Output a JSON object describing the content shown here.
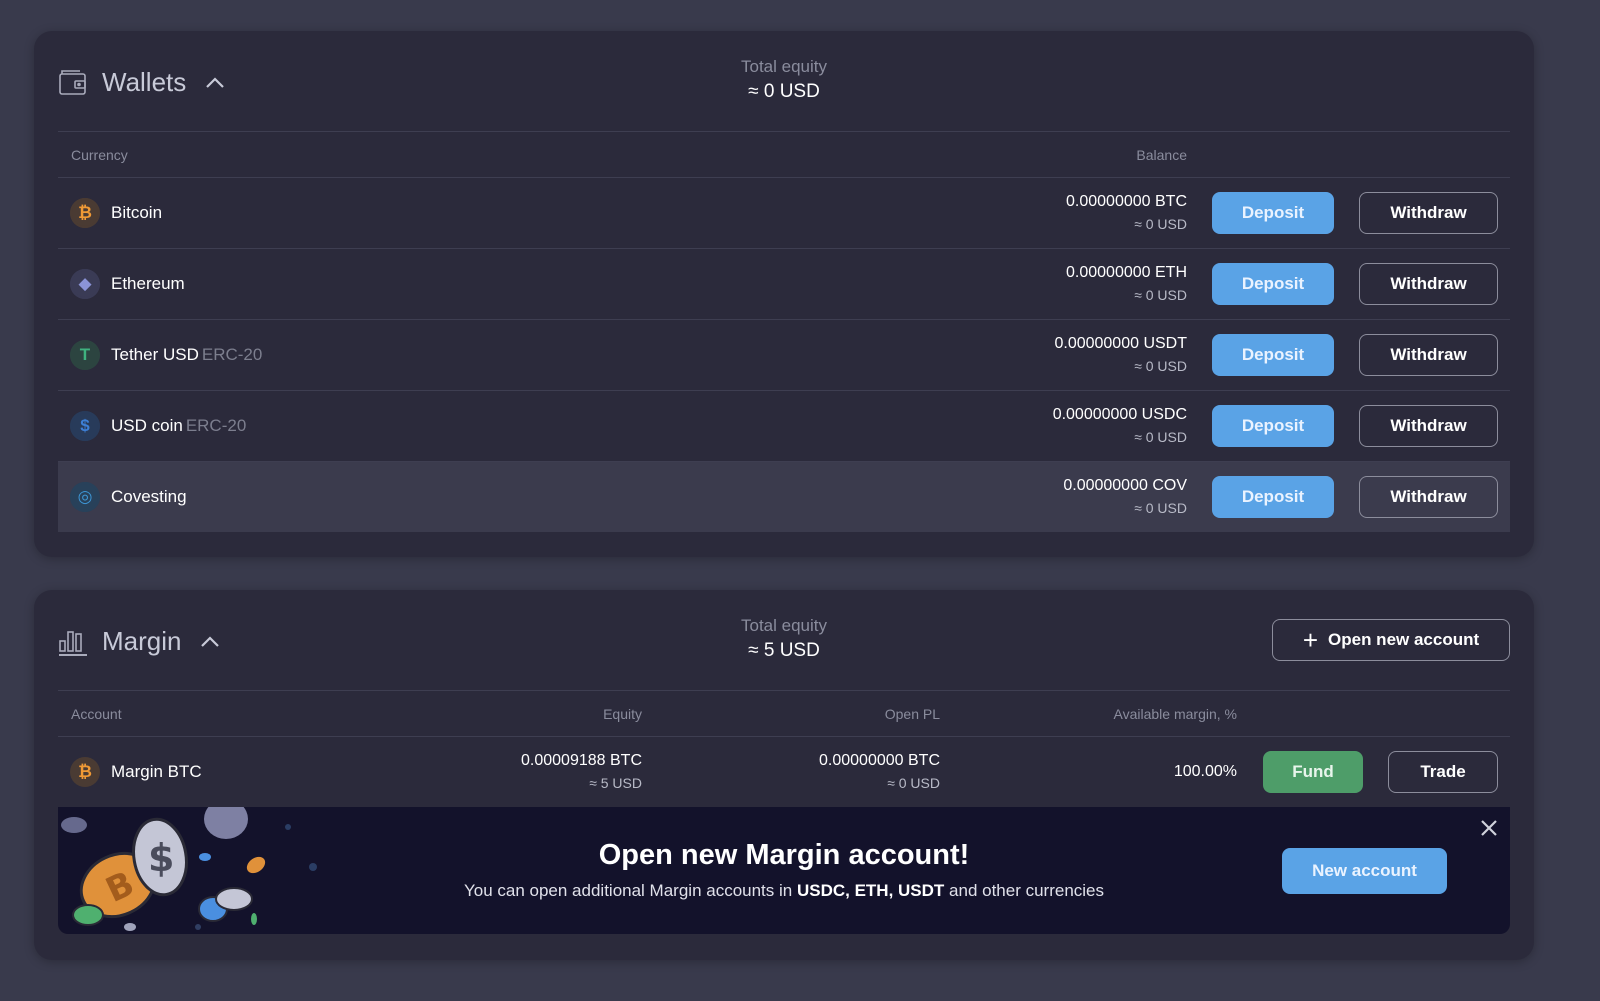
{
  "wallets": {
    "title": "Wallets",
    "total_equity_label": "Total equity",
    "total_equity_value": "≈ 0 USD",
    "columns": {
      "currency": "Currency",
      "balance": "Balance"
    },
    "rows": [
      {
        "icon": "bitcoin-icon",
        "name": "Bitcoin",
        "network": "",
        "balance": "0.00000000 BTC",
        "usd": "≈ 0 USD",
        "deposit": "Deposit",
        "withdraw": "Withdraw",
        "icon_color": "#f09a36",
        "icon_bg": "#4a3b33",
        "glyph": "₿"
      },
      {
        "icon": "ethereum-icon",
        "name": "Ethereum",
        "network": "",
        "balance": "0.00000000 ETH",
        "usd": "≈ 0 USD",
        "deposit": "Deposit",
        "withdraw": "Withdraw",
        "icon_color": "#8b93d6",
        "icon_bg": "#3a3b55",
        "glyph": "◆"
      },
      {
        "icon": "tether-icon",
        "name": "Tether USD",
        "network": "ERC-20",
        "balance": "0.00000000 USDT",
        "usd": "≈ 0 USD",
        "deposit": "Deposit",
        "withdraw": "Withdraw",
        "icon_color": "#3fb27f",
        "icon_bg": "#2c4440",
        "glyph": "T"
      },
      {
        "icon": "usd-coin-icon",
        "name": "USD coin",
        "network": "ERC-20",
        "balance": "0.00000000 USDC",
        "usd": "≈ 0 USD",
        "deposit": "Deposit",
        "withdraw": "Withdraw",
        "icon_color": "#3d7fd6",
        "icon_bg": "#283b5a",
        "glyph": "$"
      },
      {
        "icon": "covesting-icon",
        "name": "Covesting",
        "network": "",
        "balance": "0.00000000 COV",
        "usd": "≈ 0 USD",
        "deposit": "Deposit",
        "withdraw": "Withdraw",
        "icon_color": "#3d96d6",
        "icon_bg": "#28415a",
        "glyph": "◎"
      }
    ]
  },
  "margin": {
    "title": "Margin",
    "total_equity_label": "Total equity",
    "total_equity_value": "≈ 5 USD",
    "open_new_account": "Open new account",
    "columns": {
      "account": "Account",
      "equity": "Equity",
      "open_pl": "Open PL",
      "available_margin": "Available margin, %"
    },
    "rows": [
      {
        "name": "Margin BTC",
        "equity": "0.00009188 BTC",
        "equity_usd": "≈ 5 USD",
        "open_pl": "0.00000000 BTC",
        "open_pl_usd": "≈ 0 USD",
        "available_margin": "100.00%",
        "fund": "Fund",
        "trade": "Trade",
        "glyph": "₿"
      }
    ],
    "banner": {
      "title": "Open new Margin account!",
      "text_before": "You can open additional Margin accounts in ",
      "text_bold": "USDC, ETH, USDT",
      "text_after": " and other currencies",
      "button": "New account"
    }
  },
  "colors": {
    "accent_blue": "#5aa3e6",
    "fund_green": "#4e9d69",
    "panel_bg": "#2b2a3b",
    "page_bg": "#393a4c"
  }
}
